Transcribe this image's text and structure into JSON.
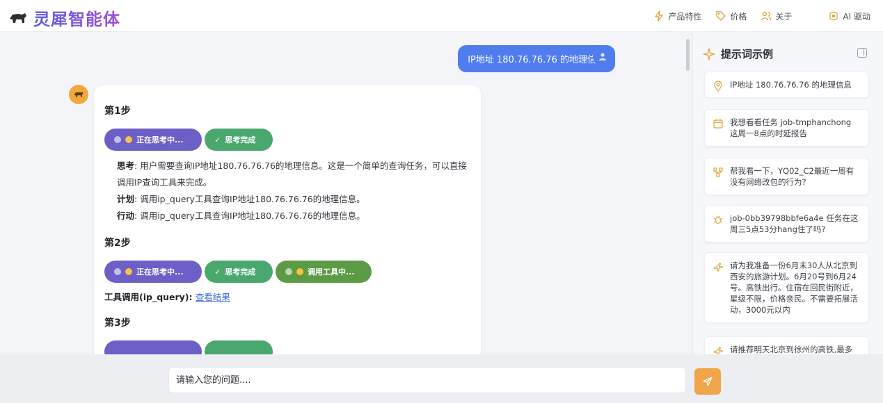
{
  "app": {
    "title": "灵犀智能体"
  },
  "nav": {
    "features": "产品特性",
    "pricing": "价格",
    "about": "关于",
    "ai_driver": "AI 驱动"
  },
  "chat": {
    "user_message": "IP地址 180.76.76.76 的地理信息",
    "steps": [
      {
        "title": "第1步",
        "chips": [
          "正在思考中...",
          "思考完成"
        ],
        "think_label": "思考",
        "think_text": ": 用户需要查询IP地址180.76.76.76的地理信息。这是一个简单的查询任务，可以直接调用IP查询工具来完成。",
        "plan_label": "计划",
        "plan_text": ": 调用ip_query工具查询IP地址180.76.76.76的地理信息。",
        "action_label": "行动",
        "action_text": ": 调用ip_query工具查询IP地址180.76.76.76的地理信息。"
      },
      {
        "title": "第2步",
        "chips": [
          "正在思考中...",
          "思考完成",
          "调用工具中..."
        ],
        "tool_call_label": "工具调用(ip_query): ",
        "tool_link": "查看结果"
      },
      {
        "title": "第3步"
      }
    ]
  },
  "sidebar": {
    "title": "提示词示例",
    "prompts": [
      "IP地址 180.76.76.76 的地理信息",
      "我想看看任务 job-tmphanchong 这周一8点的时延报告",
      "帮我看一下，YQ02_C2最近一周有没有网络改包的行为?",
      "job-0bb39798bbfe6a4e 任务在这周三5点53分hang住了吗?",
      "请为我准备一份6月末30人从北京到西安的旅游计划。6月20号到6月24号。高铁出行。住宿在回民街附近，星级不限，价格亲民。不需要拓展活动，3000元以内",
      "请推荐明天北京到徐州的高铁,最多"
    ]
  },
  "input": {
    "placeholder": "请输入您的问题...."
  },
  "colors": {
    "user_bubble": "#4f7df0",
    "chip_thinking": "#6c5fc7",
    "chip_done": "#4aa76e",
    "chip_tool": "#5c9b45",
    "send_button": "#f0a548",
    "link": "#3a6be0"
  }
}
